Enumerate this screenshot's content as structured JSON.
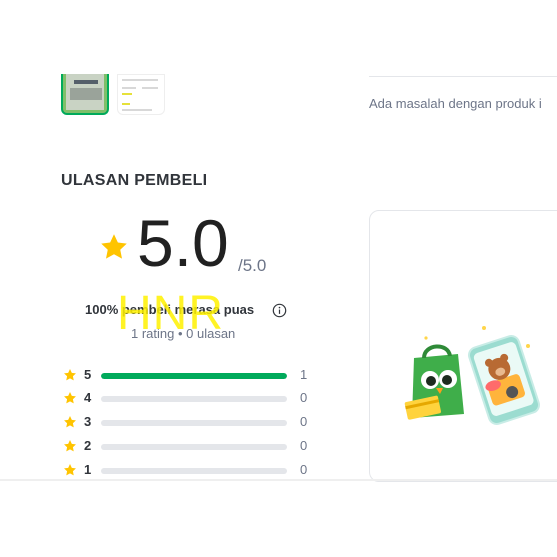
{
  "gallery": {
    "thumbnails": [
      {
        "name": "product-photo-1",
        "active": true
      },
      {
        "name": "product-photo-2",
        "active": false
      }
    ]
  },
  "help": {
    "problem_text": "Ada masalah dengan produk i"
  },
  "reviews": {
    "section_title": "ULASAN PEMBELI",
    "score": "5.0",
    "score_max": "/5.0",
    "satisfied_text": "100% pembeli merasa puas",
    "rating_summary": "1 rating • 0 ulasan",
    "star_color": "#ffc400",
    "bar_color": "#00aa5b",
    "breakdown": [
      {
        "stars": "5",
        "count": "1",
        "fraction": 1.0
      },
      {
        "stars": "4",
        "count": "0",
        "fraction": 0
      },
      {
        "stars": "3",
        "count": "0",
        "fraction": 0
      },
      {
        "stars": "2",
        "count": "0",
        "fraction": 0
      },
      {
        "stars": "1",
        "count": "0",
        "fraction": 0
      }
    ]
  },
  "watermark": {
    "text": "HNR"
  },
  "promo": {
    "illustration": "mascot-shopping-illustration"
  },
  "icons": {
    "star": "star-icon",
    "info": "info-icon"
  }
}
